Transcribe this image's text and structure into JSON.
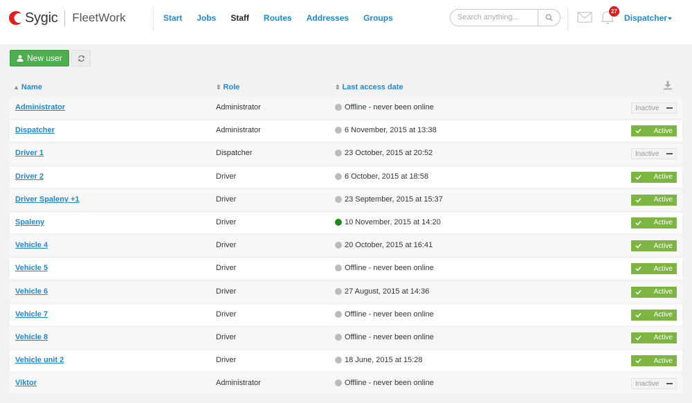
{
  "brand": {
    "name": "Sygic",
    "product": "FleetWork",
    "accent": "#e31b1b"
  },
  "nav": {
    "items": [
      {
        "label": "Start",
        "active": false
      },
      {
        "label": "Jobs",
        "active": false
      },
      {
        "label": "Staff",
        "active": true
      },
      {
        "label": "Routes",
        "active": false
      },
      {
        "label": "Addresses",
        "active": false
      },
      {
        "label": "Groups",
        "active": false
      }
    ]
  },
  "search": {
    "placeholder": "Search anything...",
    "value": "",
    "icon": "search-icon"
  },
  "header": {
    "mail_icon": "envelope-icon",
    "notifications_icon": "bell-icon",
    "notifications_count": "27",
    "user_label": "Dispatcher"
  },
  "toolbar": {
    "new_user_label": "New user",
    "new_user_icon": "user-icon",
    "refresh_icon": "refresh-icon"
  },
  "table": {
    "columns": {
      "name": "Name",
      "role": "Role",
      "last_access": "Last access date"
    },
    "download_icon": "download-icon",
    "rows": [
      {
        "name": "Administrator",
        "role": "Administrator",
        "last_access": "Offline - never been online",
        "online": false,
        "status": "Inactive",
        "active": false
      },
      {
        "name": "Dispatcher",
        "role": "Administrator",
        "last_access": "6 November, 2015 at 13:38",
        "online": false,
        "status": "Active",
        "active": true
      },
      {
        "name": "Driver 1",
        "role": "Dispatcher",
        "last_access": "23 October, 2015 at 20:52",
        "online": false,
        "status": "Inactive",
        "active": false
      },
      {
        "name": "Driver 2",
        "role": "Driver",
        "last_access": "6 October, 2015 at 18:58",
        "online": false,
        "status": "Active",
        "active": true
      },
      {
        "name": "Driver Spaleny +1",
        "role": "Driver",
        "last_access": "23 September, 2015 at 15:37",
        "online": false,
        "status": "Active",
        "active": true
      },
      {
        "name": "Spaleny",
        "role": "Driver",
        "last_access": "10 November, 2015 at 14:20",
        "online": true,
        "status": "Active",
        "active": true
      },
      {
        "name": "Vehicle 4",
        "role": "Driver",
        "last_access": "20 October, 2015 at 16:41",
        "online": false,
        "status": "Active",
        "active": true
      },
      {
        "name": "Vehicle 5",
        "role": "Driver",
        "last_access": "Offline - never been online",
        "online": false,
        "status": "Active",
        "active": true
      },
      {
        "name": "Vehicle 6",
        "role": "Driver",
        "last_access": "27 August, 2015 at 14:36",
        "online": false,
        "status": "Active",
        "active": true
      },
      {
        "name": "Vehicle 7",
        "role": "Driver",
        "last_access": "Offline - never been online",
        "online": false,
        "status": "Active",
        "active": true
      },
      {
        "name": "Vehicle 8",
        "role": "Driver",
        "last_access": "Offline - never been online",
        "online": false,
        "status": "Active",
        "active": true
      },
      {
        "name": "Vehicle unit 2",
        "role": "Driver",
        "last_access": "18 June, 2015 at 15:28",
        "online": false,
        "status": "Active",
        "active": true
      },
      {
        "name": "Viktor",
        "role": "Administrator",
        "last_access": "Offline - never been online",
        "online": false,
        "status": "Inactive",
        "active": false
      }
    ]
  },
  "colors": {
    "link": "#1e88d6",
    "active_toggle": "#7db543",
    "online_dot": "#1a8a1a",
    "offline_dot": "#bbbbbb",
    "primary_button": "#4cae4c"
  }
}
